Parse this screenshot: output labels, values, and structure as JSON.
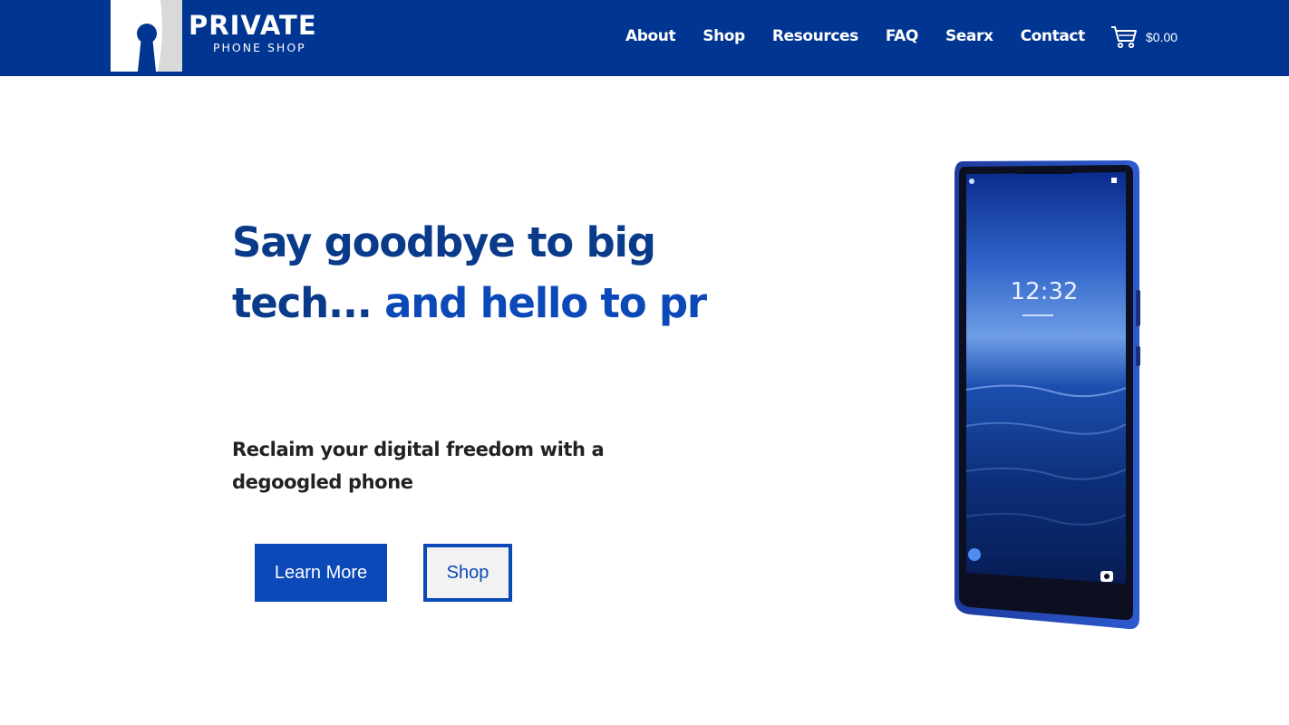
{
  "header": {
    "logo": {
      "title": "PRIVATE",
      "subtitle": "PHONE SHOP"
    },
    "nav": [
      "About",
      "Shop",
      "Resources",
      "FAQ",
      "Searx",
      "Contact"
    ],
    "cart": {
      "icon": "cart-icon",
      "total": "$0.00"
    }
  },
  "hero": {
    "headline_line1": "Say goodbye to big",
    "headline_line2_start": "tech...",
    "headline_line2_accent": "and hello to pr",
    "tagline": "Reclaim your digital freedom with a degoogled phone",
    "buttons": {
      "learn_more": "Learn More",
      "shop": "Shop"
    },
    "phone": {
      "clock": "12:32"
    }
  },
  "colors": {
    "brand": "#003591",
    "accent": "#0b48b8",
    "headline": "#0a3a8a"
  }
}
